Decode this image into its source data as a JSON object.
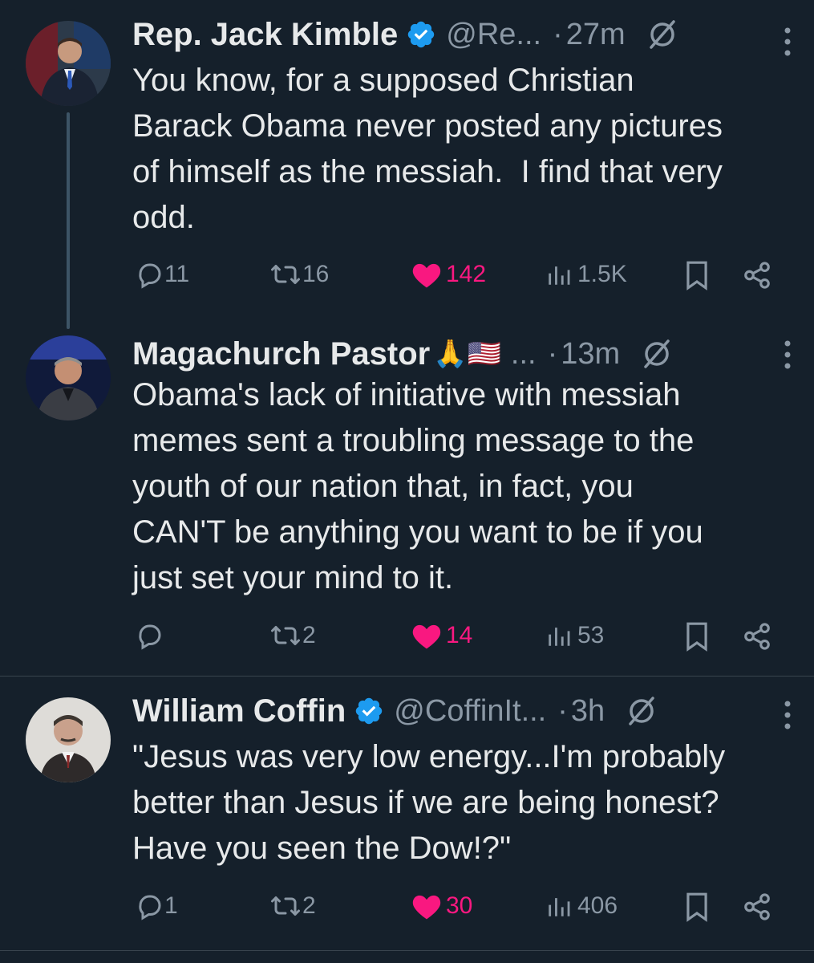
{
  "tweets": [
    {
      "name": "Rep. Jack Kimble",
      "verified": true,
      "handle": "@Re...",
      "time": "27m",
      "text": "You know, for a supposed Christian\nBarack Obama never posted any pictures\nof himself as the messiah.  I find that very\nodd.",
      "replies": "11",
      "retweets": "16",
      "likes": "142",
      "views": "1.5K",
      "avatar_icon": "avatar-man-suit-flag"
    },
    {
      "name": "Magachurch Pastor",
      "emoji": "🙏🇺🇸",
      "ellipsis": "...",
      "time": "13m",
      "text": "Obama's lack of initiative with messiah\nmemes sent a troubling message to the\nyouth of our nation that, in fact, you\nCAN'T be anything you want to be if you\njust set your mind to it.",
      "replies": "",
      "retweets": "2",
      "likes": "14",
      "views": "53",
      "avatar_icon": "avatar-man-stage"
    },
    {
      "name": "William Coffin",
      "verified": true,
      "handle": "@CoffinIt...",
      "time": "3h",
      "text": "\"Jesus was very low energy...I'm probably\nbetter than Jesus if we are being honest?\nHave you seen the Dow!?\"",
      "replies": "1",
      "retweets": "2",
      "likes": "30",
      "views": "406",
      "avatar_icon": "avatar-vintage-portrait"
    }
  ],
  "separator": "·",
  "colors": {
    "background": "#15202b",
    "text": "#e7e9ea",
    "muted": "#8b98a5",
    "like": "#f91880",
    "verified": "#1d9bf0",
    "thread_line": "#3d5466"
  }
}
